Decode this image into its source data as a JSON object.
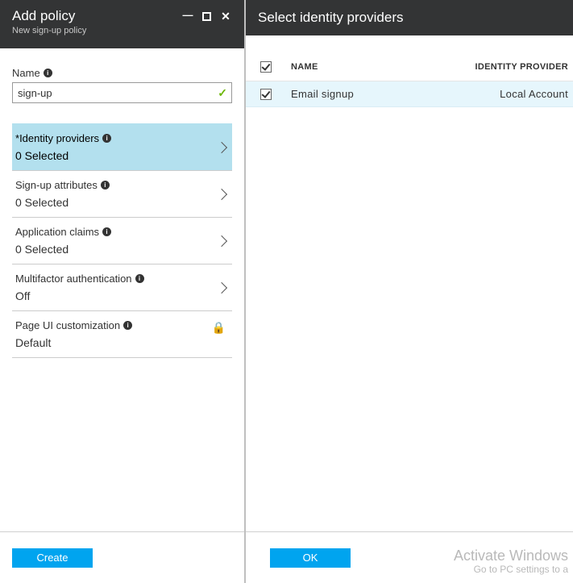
{
  "left": {
    "title": "Add policy",
    "subtitle": "New sign-up policy",
    "name_label": "Name",
    "name_value": "sign-up",
    "settings": [
      {
        "id": "identity-providers",
        "label": "Identity providers",
        "value": "0 Selected",
        "required": true,
        "chevron": true,
        "selected": true
      },
      {
        "id": "signup-attributes",
        "label": "Sign-up attributes",
        "value": "0 Selected",
        "required": false,
        "chevron": true,
        "selected": false
      },
      {
        "id": "application-claims",
        "label": "Application claims",
        "value": "0 Selected",
        "required": false,
        "chevron": true,
        "selected": false
      },
      {
        "id": "mfa",
        "label": "Multifactor authentication",
        "value": "Off",
        "required": false,
        "chevron": true,
        "selected": false
      },
      {
        "id": "page-ui",
        "label": "Page UI customization",
        "value": "Default",
        "required": false,
        "chevron": false,
        "locked": true,
        "selected": false
      }
    ],
    "create_btn": "Create"
  },
  "right": {
    "title": "Select identity providers",
    "columns": {
      "name": "NAME",
      "type": "IDENTITY PROVIDER"
    },
    "rows": [
      {
        "name": "Email signup",
        "type": "Local Account",
        "checked": true
      }
    ],
    "ok_btn": "OK"
  },
  "watermark": {
    "l1": "Activate Windows",
    "l2": "Go to PC settings to a"
  }
}
